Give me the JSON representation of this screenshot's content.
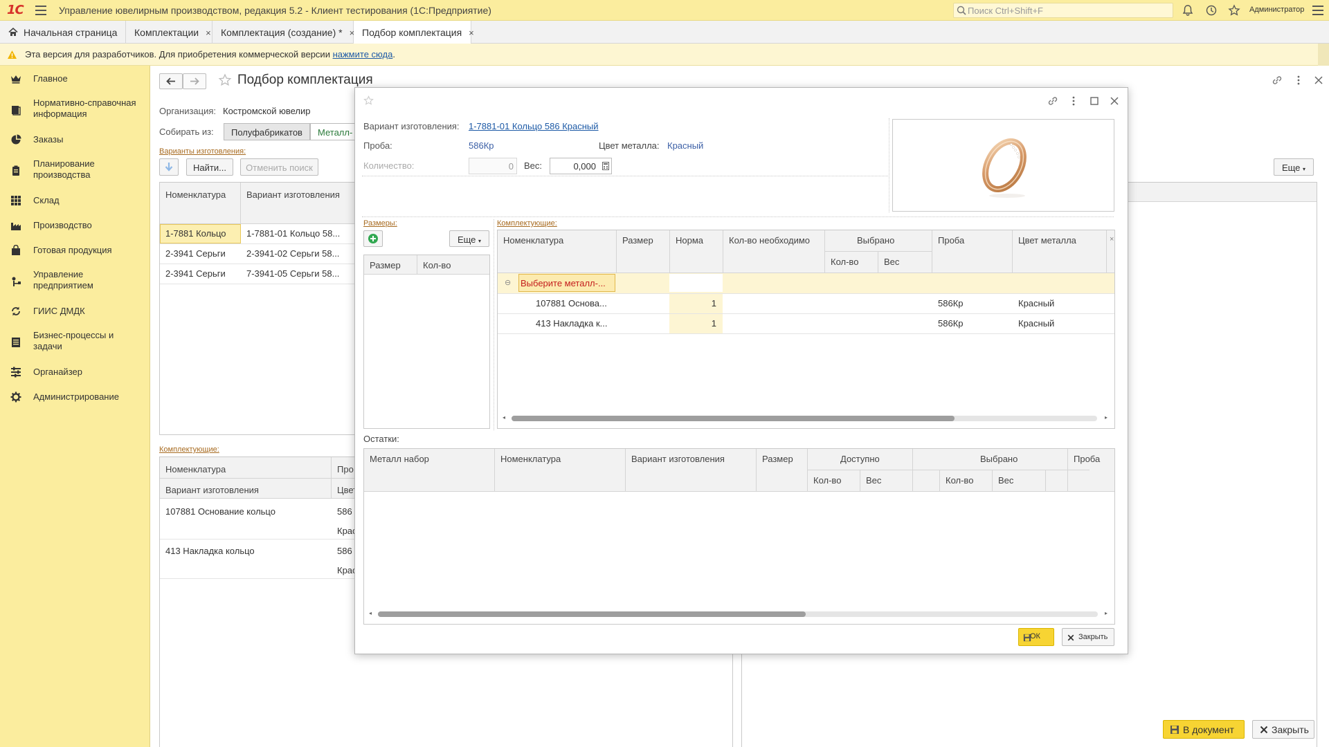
{
  "topbar": {
    "logo": "1С",
    "title": "Управление ювелирным производством, редакция 5.2  - Клиент тестирования (1С:Предприятие)",
    "search_placeholder": "Поиск Ctrl+Shift+F",
    "user": "Администратор"
  },
  "tabs": [
    {
      "label": "Начальная страница"
    },
    {
      "label": "Комплектации"
    },
    {
      "label": "Комплектация (создание) *"
    },
    {
      "label": "Подбор комплектация"
    }
  ],
  "tab_close": "×",
  "warning": {
    "text": "Эта версия для разработчиков. Для приобретения коммерческой версии ",
    "link": "нажмите сюда",
    "tail": "."
  },
  "sidebar": {
    "items": [
      {
        "label": "Главное",
        "icon": "crown-icon"
      },
      {
        "label": "Нормативно-справочная информация",
        "icon": "book-icon"
      },
      {
        "label": "Заказы",
        "icon": "pie-chart-icon"
      },
      {
        "label": "Планирование производства",
        "icon": "clipboard-icon"
      },
      {
        "label": "Склад",
        "icon": "grid-icon"
      },
      {
        "label": "Производство",
        "icon": "factory-icon"
      },
      {
        "label": "Готовая продукция",
        "icon": "bag-icon"
      },
      {
        "label": "Управление предприятием",
        "icon": "org-icon"
      },
      {
        "label": "ГИИС ДМДК",
        "icon": "sync-icon"
      },
      {
        "label": "Бизнес-процессы и задачи",
        "icon": "tasks-icon"
      },
      {
        "label": "Органайзер",
        "icon": "organizer-icon"
      },
      {
        "label": "Администрирование",
        "icon": "gear-icon"
      }
    ]
  },
  "main": {
    "title": "Подбор комплектация",
    "org_label": "Организация:",
    "org_value": "Костромской ювелир",
    "collect_label": "Собирать из:",
    "collect_options": [
      "Полуфабрикатов",
      "Металл-"
    ],
    "variants_section": "Варианты изготовления:",
    "find_button": "Найти...",
    "cancel_search_button": "Отменить поиск",
    "more_button": "Еще",
    "variants_grid": {
      "columns": [
        "Номенклатура",
        "Вариант изготовления"
      ],
      "rows": [
        [
          "1-7881 Кольцо",
          "1-7881-01 Кольцо 58..."
        ],
        [
          "2-3941 Серьги",
          "2-3941-02 Серьги 58..."
        ],
        [
          "2-3941 Серьги",
          "7-3941-05 Серьги 58..."
        ]
      ]
    },
    "components_section": "Комплектующие:",
    "components_grid": {
      "columns": [
        "Номенклатура",
        "Про"
      ],
      "columns2": [
        "Вариант изготовления",
        "Цвет"
      ],
      "rows": [
        [
          "107881 Основание кольцо",
          "586",
          "Крас"
        ],
        [
          "413 Накладка кольцо",
          "586",
          "Крас"
        ]
      ]
    },
    "to_document_button": "В документ",
    "close_button": "Закрыть"
  },
  "modal": {
    "variant_label": "Вариант изготовления:",
    "variant_value": "1-7881-01 Кольцо 586 Красный",
    "probe_label": "Проба:",
    "probe_value": "586Кр",
    "metal_color_label": "Цвет металла:",
    "metal_color_value": "Красный",
    "qty_label": "Количество:",
    "qty_value": "0",
    "weight_label": "Вес:",
    "weight_value": "0,000",
    "sizes_section": "Размеры:",
    "sizes_more": "Еще",
    "sizes_columns": [
      "Размер",
      "Кол-во"
    ],
    "comp_section": "Комплектующие:",
    "comp_columns": [
      "Номенклатура",
      "Размер",
      "Норма",
      "Кол-во  необходимо",
      "Выбрано",
      "Проба",
      "Цвет металла"
    ],
    "comp_subcolumns": [
      "Кол-во",
      "Вес"
    ],
    "comp_rows": [
      {
        "name": "Выберите металл-...",
        "norm": "",
        "probe": "",
        "color": ""
      },
      {
        "name": "107881 Основа...",
        "norm": "1",
        "probe": "586Кр",
        "color": "Красный"
      },
      {
        "name": "413 Накладка к...",
        "norm": "1",
        "probe": "586Кр",
        "color": "Красный"
      }
    ],
    "rests_label": "Остатки:",
    "rests_columns": [
      "Металл набор",
      "Номенклатура",
      "Вариант изготовления",
      "Размер",
      "Доступно",
      "Выбрано",
      "Проба"
    ],
    "rests_subcolumns": [
      "Кол-во",
      "Вес",
      "Кол-во",
      "Вес"
    ],
    "ok_button": "ОК",
    "close_button": "Закрыть"
  },
  "colors": {
    "accent_yellow": "#fbed9e",
    "button_yellow": "#f7d433",
    "link_blue": "#1d5aa6",
    "section_brown": "#a76a1f"
  }
}
